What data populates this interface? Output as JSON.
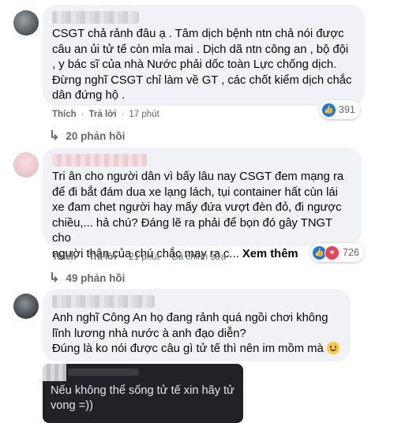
{
  "comments": [
    {
      "author": "",
      "text": "CSGT chả rảnh đâu ạ . Tâm dịch bệnh ntn chả nói được\ncâu an ủi tử tế còn mỉa mai . Dịch dã ntn công an , bộ đội\n, y bác sĩ của nhà Nước phải dốc toàn Lực chống dịch.\nĐừng nghĩ CSGT chỉ làm về GT , các chốt kiểm dịch chắc\ndân đứng hộ .",
      "like_label": "Thích",
      "reply_label": "Trả lời",
      "time": "17 phút",
      "reaction_count": "391",
      "replies_label": "20 phản hồi"
    },
    {
      "author": "",
      "text": "Tri ân cho người dân vì bấy lâu nay CSGT đem mạng ra\nđể đi bắt đám dua xe lạng lách, tụi container hất cùn lái\nxe đam chet người hay mấy đứa vượt đèn đỏ, đi ngược\nchiều,... hả chú? Đáng lẽ ra phải để bọn đó gây TNGT cho\nngười thân của chú chắc may ra c...",
      "see_more": "Xem thêm",
      "like_label": "Thích",
      "reply_label": "Trả lời",
      "time": "21 phút",
      "edited": "Đã chỉnh sửa",
      "reaction_count": "726",
      "replies_label": "49 phản hồi"
    },
    {
      "author": "",
      "text": "Anh nghĩ Công An họ đang rảnh quá ngồi chơi không\nlĩnh lương nhà nước à anh đạo diễn?\nĐúng là ko nói được câu gì tử tế thì nên im mồm mà",
      "attached_image_text": "Nếu không thể sống tử tế xin hãy tử\nvong =))"
    }
  ],
  "separator": "·"
}
